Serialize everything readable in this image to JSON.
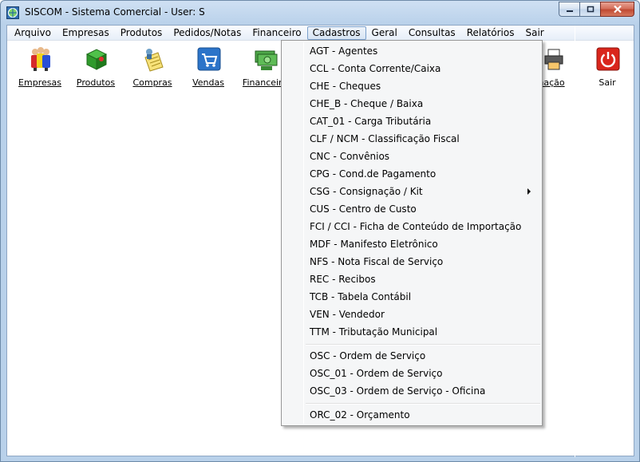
{
  "window": {
    "title": "SISCOM - Sistema Comercial - User: S"
  },
  "menubar": {
    "items": [
      "Arquivo",
      "Empresas",
      "Produtos",
      "Pedidos/Notas",
      "Financeiro",
      "Cadastros",
      "Geral",
      "Consultas",
      "Relatórios",
      "Sair"
    ],
    "active": "Cadastros"
  },
  "toolbar": {
    "items": [
      {
        "label": "Empresas",
        "icon": "people-icon"
      },
      {
        "label": "Produtos",
        "icon": "product-box-icon"
      },
      {
        "label": "Compras",
        "icon": "purchase-icon"
      },
      {
        "label": "Vendas",
        "icon": "shopping-cart-icon"
      },
      {
        "label": "Financeiro",
        "icon": "money-icon"
      },
      {
        "label": "nação",
        "icon": "printer-icon"
      },
      {
        "label": "Sair",
        "icon": "power-icon"
      }
    ]
  },
  "cadastros_menu": {
    "groups": [
      [
        "AGT - Agentes",
        "CCL - Conta Corrente/Caixa",
        "CHE - Cheques",
        "CHE_B - Cheque / Baixa",
        "CAT_01 - Carga Tributária",
        "CLF / NCM - Classificação Fiscal",
        "CNC - Convênios",
        "CPG - Cond.de Pagamento",
        "CSG - Consignação / Kit",
        "CUS - Centro de Custo",
        "FCI / CCI - Ficha de Conteúdo de Importação",
        "MDF - Manifesto Eletrônico",
        "NFS - Nota Fiscal de Serviço",
        "REC - Recibos",
        "TCB - Tabela Contábil",
        "VEN - Vendedor",
        "TTM - Tributação Municipal"
      ],
      [
        "OSC - Ordem de Serviço",
        "OSC_01 - Ordem de Serviço",
        "OSC_03 - Ordem de Serviço - Oficina"
      ],
      [
        "ORC_02 - Orçamento"
      ]
    ],
    "submenu_item": "CSG - Consignação / Kit"
  },
  "colors": {
    "titlebar": "#b9d1ea",
    "menu_bg": "#f5f6f7",
    "close_button": "#c04a33"
  }
}
